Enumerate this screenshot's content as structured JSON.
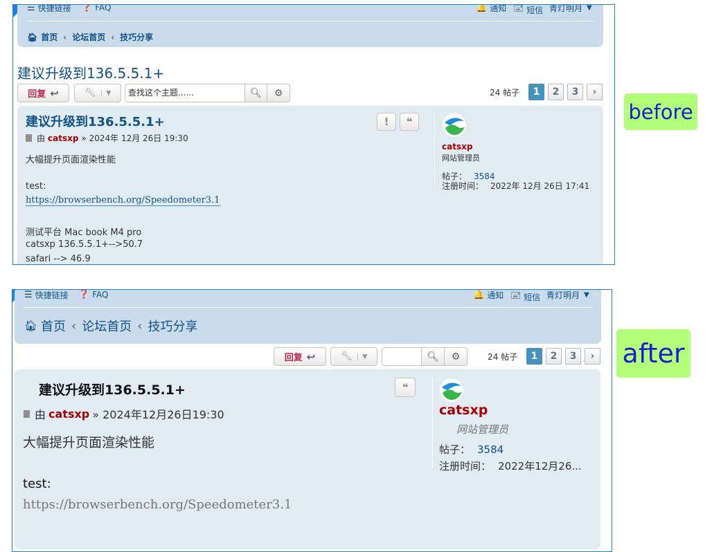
{
  "nav": {
    "quick_links": "快捷链接",
    "faq": "FAQ",
    "notifications": "通知",
    "messages": "短信",
    "username": "青灯明月",
    "breadcrumbs": [
      "首页",
      "论坛首页",
      "技巧分享"
    ]
  },
  "topic": {
    "title": "建议升级到136.5.5.1+",
    "reply_label": "回复",
    "search_placeholder": "查找这个主题......",
    "post_count": "24 帖子",
    "pages": [
      "1",
      "2",
      "3"
    ],
    "next_arrow": "›"
  },
  "post_before": {
    "title": "建议升级到136.5.5.1+",
    "by": "由",
    "author": "catsxp",
    "date": "» 2024年 12月 26日 19:30",
    "line1": "大幅提升页面渲染性能",
    "test_label": "test:",
    "link": "https://browserbench.org/Speedometer3.1",
    "platform": "测试平台 Mac book M4 pro",
    "result1": "catsxp 136.5.5.1+-->50.7",
    "result2": "safari --> 46.9"
  },
  "post_after": {
    "title": "建议升级到136.5.5.1+",
    "by": "由",
    "author": "catsxp",
    "date": "» 2024年12月26日19:30",
    "line1": "大幅提升页面渲染性能",
    "test_label": "test:",
    "link": "https://browserbench.org/Speedometer3.1"
  },
  "profile_before": {
    "name": "catsxp",
    "rank": "网站管理员",
    "posts_label": "帖子：",
    "posts": "3584",
    "joined_label": "注册时间：",
    "joined": "2022年 12月 26日 17:41"
  },
  "profile_after": {
    "name": "catsxp",
    "rank": "网站管理员",
    "posts_label": "帖子：",
    "posts": "3584",
    "joined_label": "注册时间：",
    "joined": "2022年12月26..."
  },
  "labels": {
    "before": "before",
    "after": "after"
  },
  "colors": {
    "frame_border": "#1e7ee8",
    "navbar_bg": "#cadceb",
    "post_bg": "#e1ebf2",
    "link": "#105289",
    "author": "#aa0000",
    "reply": "#bc2a4d",
    "page_active": "#4692bf",
    "label_bg": "#b2ff7a",
    "label_text": "#1a1ed0"
  }
}
